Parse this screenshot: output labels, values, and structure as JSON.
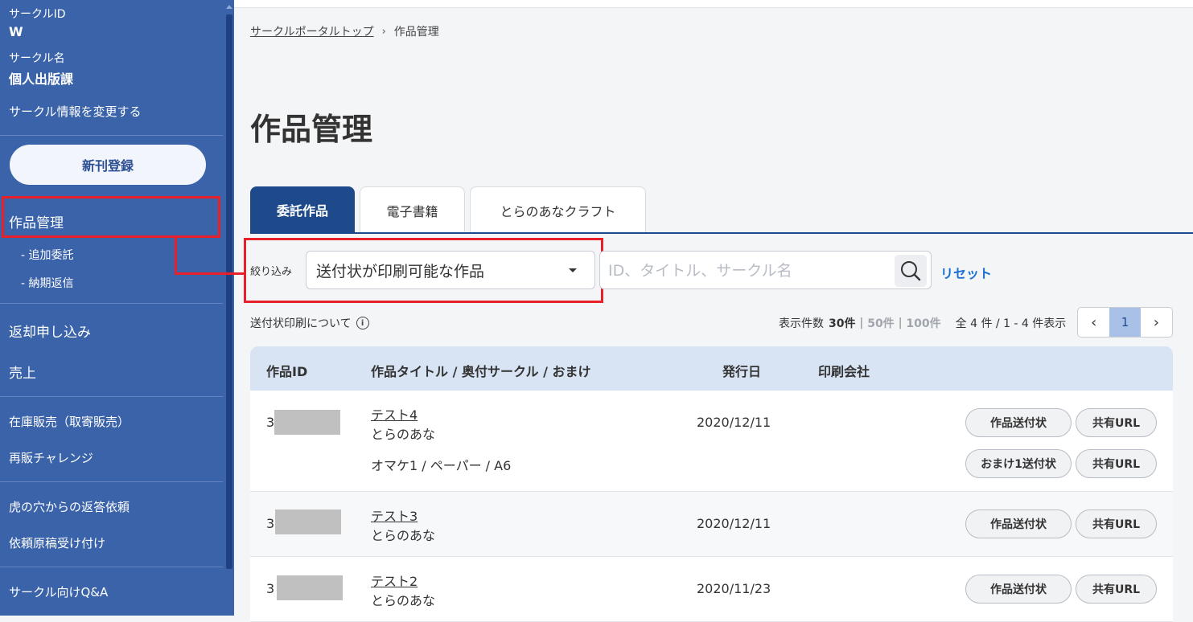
{
  "sidebar": {
    "circle_id_label": "サークルID",
    "circle_id_value": "W",
    "circle_name_label": "サークル名",
    "circle_name_value": "個人出版課",
    "edit_circle_info": "サークル情報を変更する",
    "new_registration": "新刊登録",
    "items": {
      "works": "作品管理",
      "additional_consign": "- 追加委託",
      "delivery_reply": "- 納期返信",
      "return_request": "返却申し込み",
      "sales": "売上",
      "stock_sale": "在庫販売（取寄販売）",
      "resale_challenge": "再販チャレンジ",
      "tora_reply": "虎の穴からの返答依頼",
      "manuscript": "依頼原稿受け付け",
      "qa": "サークル向けQ&A"
    }
  },
  "breadcrumb": {
    "top": "サークルポータルトップ",
    "sep": "›",
    "current": "作品管理"
  },
  "page_title": "作品管理",
  "tabs": [
    {
      "label": "委託作品",
      "active": true
    },
    {
      "label": "電子書籍",
      "active": false
    },
    {
      "label": "とらのあなクラフト",
      "active": false
    }
  ],
  "filter": {
    "label": "絞り込み",
    "selected": "送付状が印刷可能な作品"
  },
  "search": {
    "placeholder": "ID、タイトル、サークル名",
    "icon": "search-icon"
  },
  "reset_label": "リセット",
  "info_link": "送付状印刷について",
  "counts": {
    "label": "表示件数",
    "opt30": "30件",
    "opt50": "50件",
    "opt100": "100件",
    "sep": "|",
    "summary": "全 4 件 / 1 - 4 件表示"
  },
  "pager": {
    "prev": "‹",
    "current": "1",
    "next": "›"
  },
  "table": {
    "headers": {
      "id": "作品ID",
      "title": "作品タイトル / 奥付サークル / おまけ",
      "date": "発行日",
      "printer": "印刷会社"
    },
    "rows": [
      {
        "id_prefix": "3",
        "title": "テスト4",
        "circle": "とらのあな",
        "omake": "オマケ1 / ペーパー / A6",
        "date": "2020/12/11",
        "btn_invoice": "作品送付状",
        "btn_share": "共有URL",
        "btn_omake_invoice": "おまけ1送付状",
        "btn_omake_share": "共有URL"
      },
      {
        "id_prefix": "3",
        "title": "テスト3",
        "circle": "とらのあな",
        "date": "2020/12/11",
        "btn_invoice": "作品送付状",
        "btn_share": "共有URL"
      },
      {
        "id_prefix": "3",
        "title": "テスト2",
        "circle": "とらのあな",
        "date": "2020/11/23",
        "btn_invoice": "作品送付状",
        "btn_share": "共有URL"
      }
    ]
  },
  "colors": {
    "sidebar_bg": "#3a63a9",
    "accent": "#1e4a8c",
    "highlight": "#e8202a",
    "link": "#1c6fd1"
  }
}
